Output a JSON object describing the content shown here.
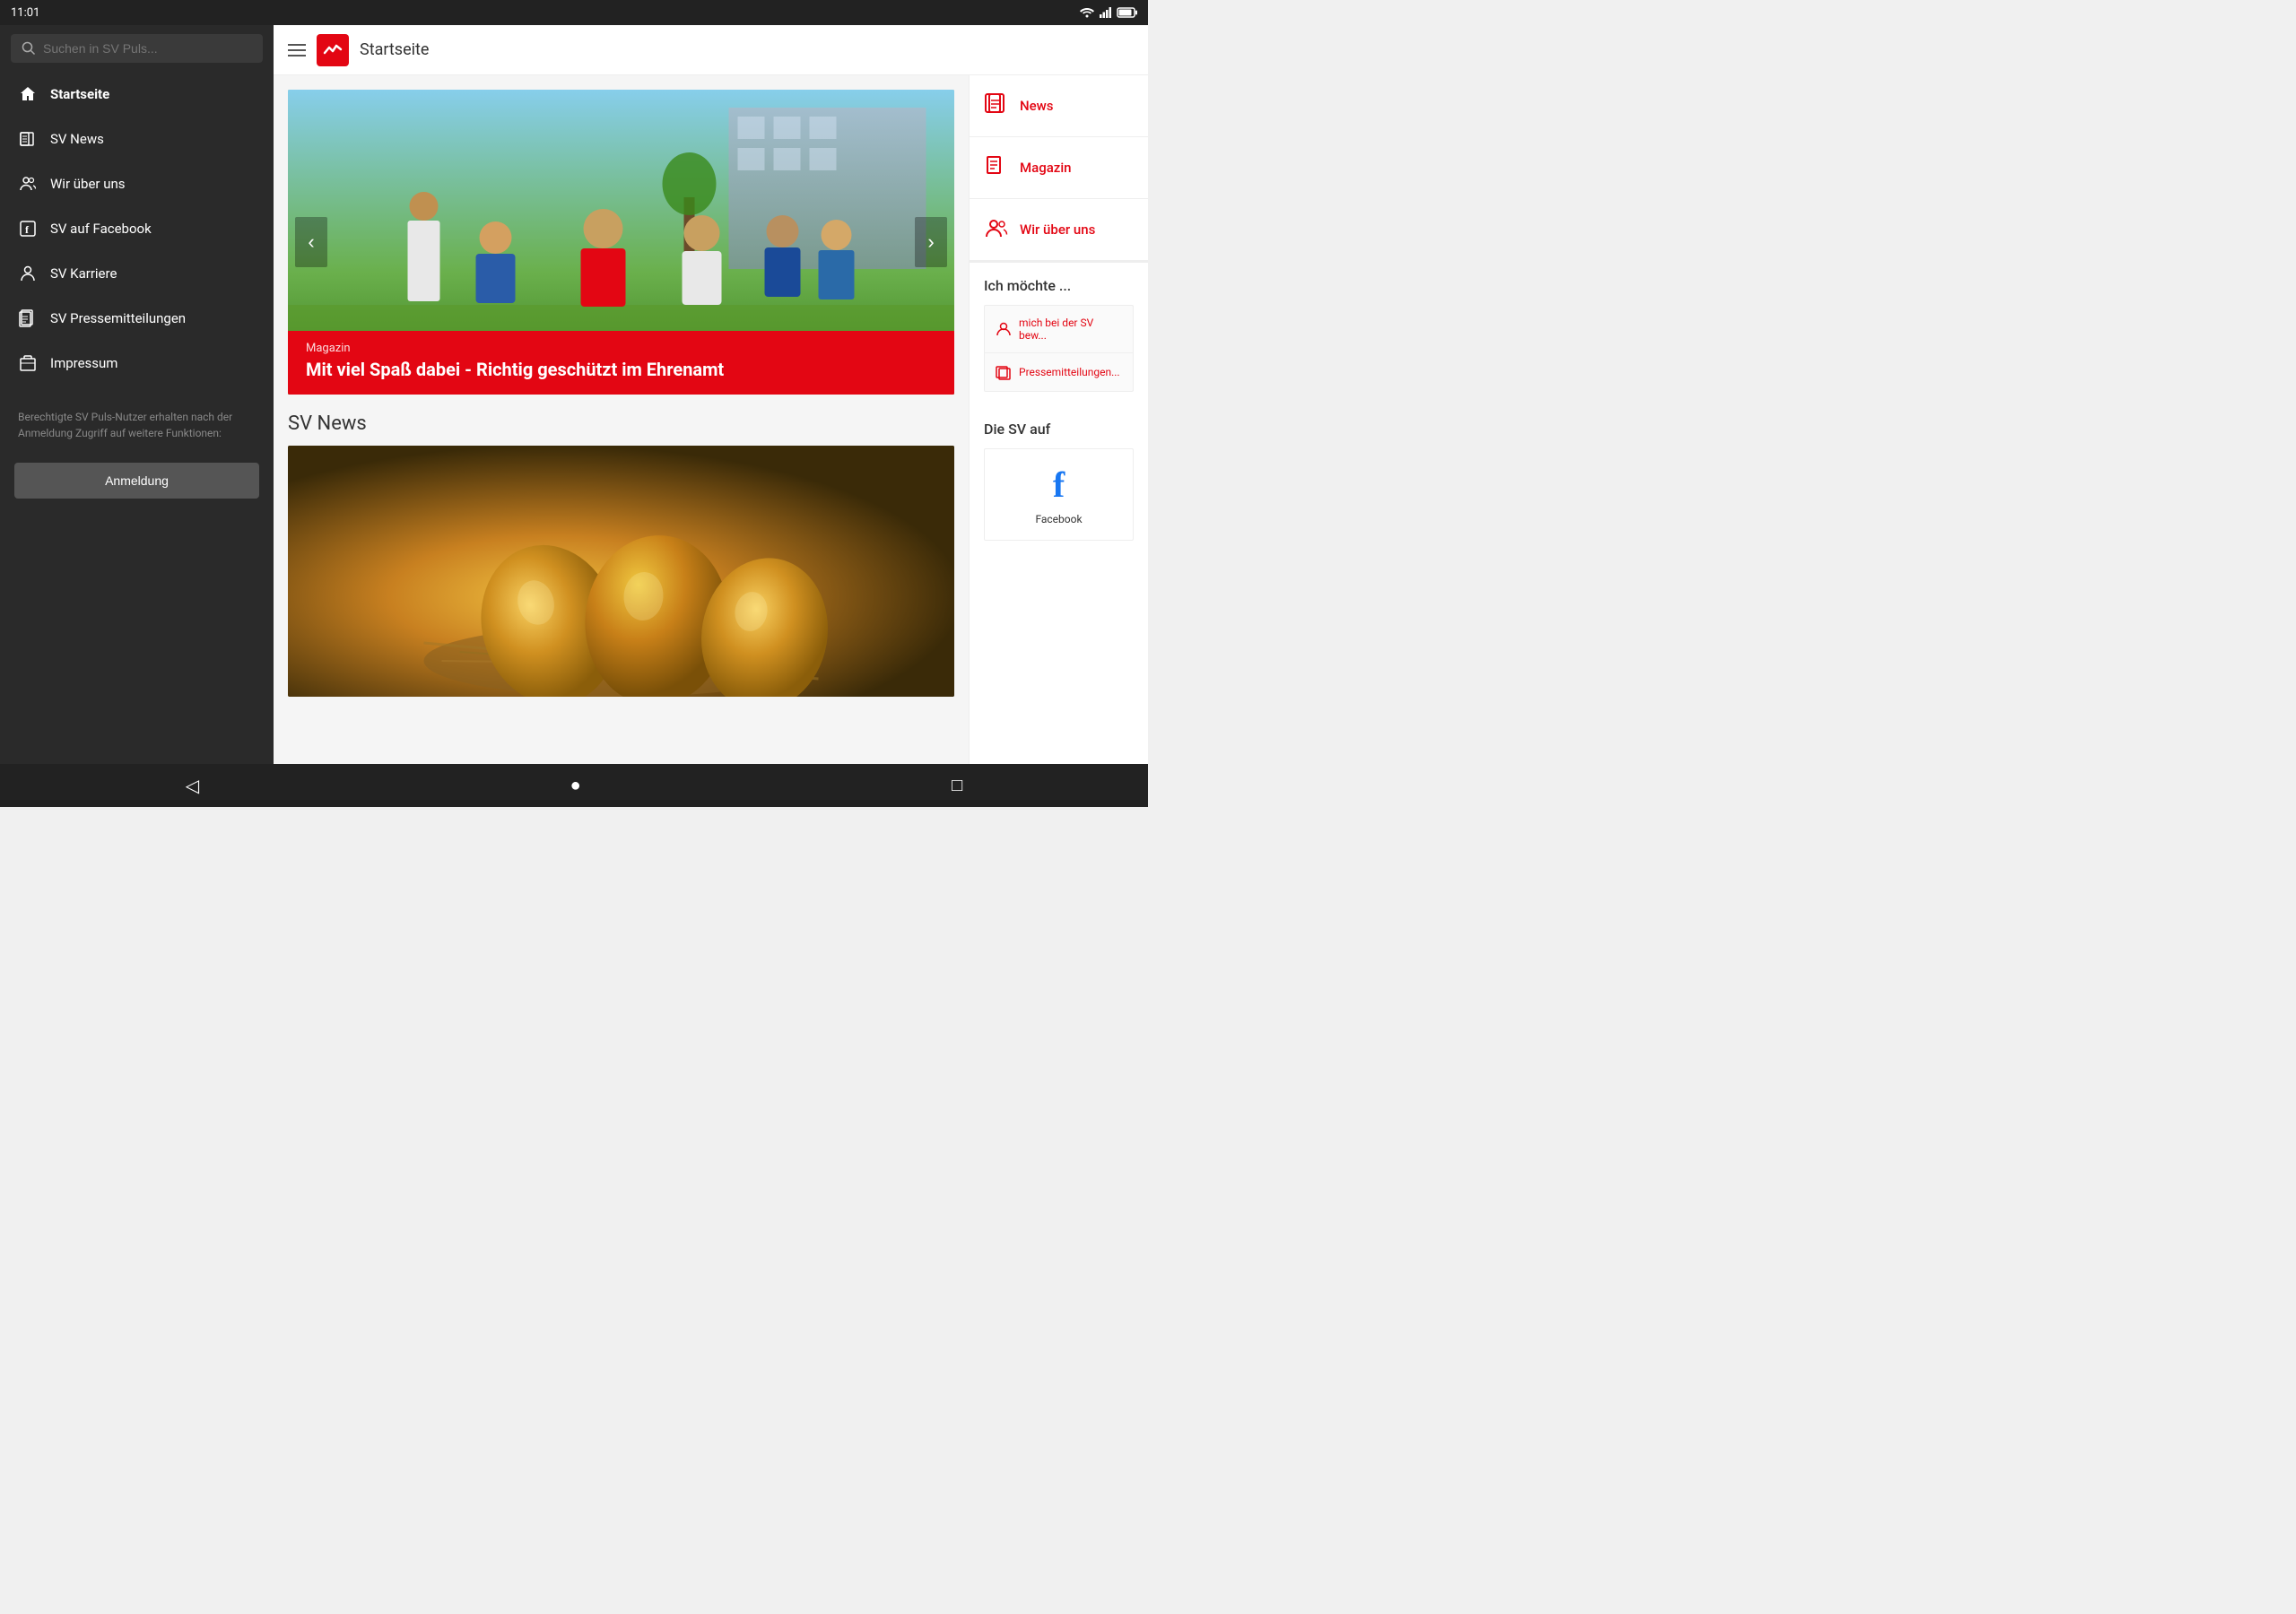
{
  "status_bar": {
    "time": "11:01",
    "icons": [
      "wifi",
      "signal",
      "battery"
    ]
  },
  "sidebar": {
    "search_placeholder": "Suchen in SV Puls...",
    "nav_items": [
      {
        "id": "startseite",
        "label": "Startseite",
        "icon": "home",
        "active": true
      },
      {
        "id": "sv-news",
        "label": "SV News",
        "icon": "newspaper"
      },
      {
        "id": "wir-uber-uns",
        "label": "Wir über uns",
        "icon": "people"
      },
      {
        "id": "sv-facebook",
        "label": "SV auf Facebook",
        "icon": "facebook"
      },
      {
        "id": "sv-karriere",
        "label": "SV Karriere",
        "icon": "person"
      },
      {
        "id": "sv-pressemitteilungen",
        "label": "SV Pressemitteilungen",
        "icon": "document"
      },
      {
        "id": "impressum",
        "label": "Impressum",
        "icon": "box"
      }
    ],
    "info_text": "Berechtigte SV Puls-Nutzer erhalten nach der Anmeldung Zugriff auf weitere Funktionen:",
    "anmeldung_label": "Anmeldung"
  },
  "top_bar": {
    "title": "Startseite",
    "logo_text": "⚡"
  },
  "hero": {
    "category": "Magazin",
    "title": "Mit viel Spaß dabei - Richtig geschützt im Ehrenamt",
    "arrow_left": "‹",
    "arrow_right": "›"
  },
  "main": {
    "sv_news_title": "SV News"
  },
  "right_sidebar": {
    "nav_items": [
      {
        "id": "news",
        "label": "News",
        "icon": "news-doc"
      },
      {
        "id": "magazin",
        "label": "Magazin",
        "icon": "magazin-doc"
      },
      {
        "id": "wir-uber-uns",
        "label": "Wir über uns",
        "icon": "people-circle"
      }
    ],
    "ich_mochte_title": "Ich möchte ...",
    "ich_mochte_items": [
      {
        "id": "bewerben",
        "label": "mich bei der SV bew..."
      },
      {
        "id": "pressemitteilungen",
        "label": "Pressemitteilungen..."
      }
    ],
    "die_sv_title": "Die SV auf",
    "facebook_label": "Facebook"
  },
  "bottom_nav": {
    "back_label": "◁",
    "home_label": "●",
    "square_label": "□"
  }
}
